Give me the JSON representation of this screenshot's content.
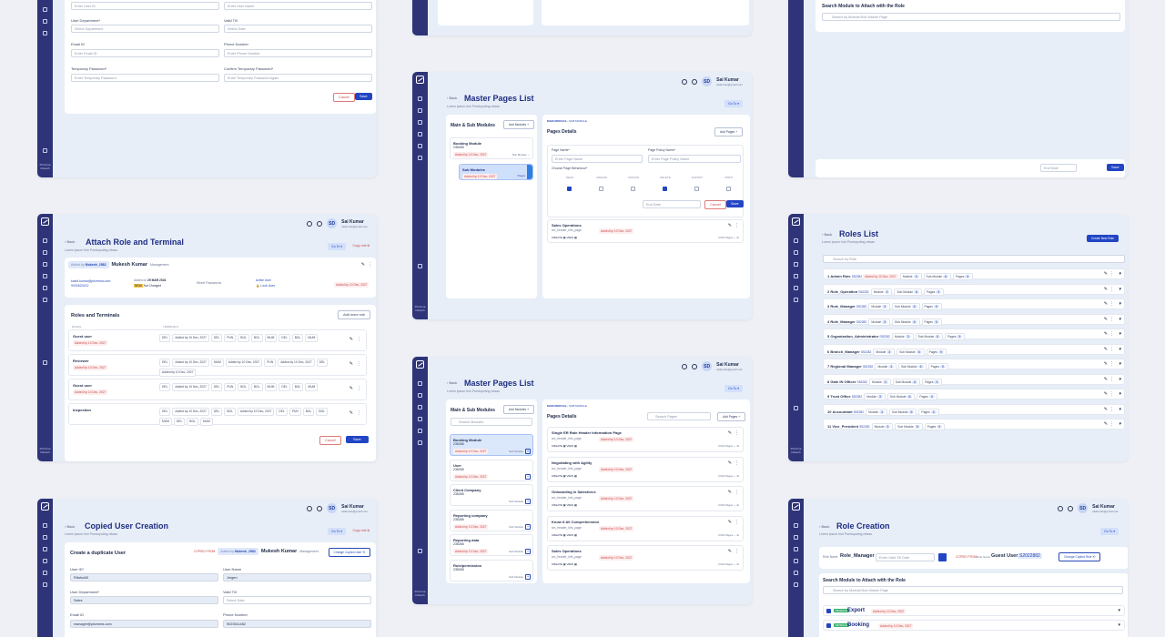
{
  "brand": {
    "sidebar_footer": "Prizmma Infotech"
  },
  "user": {
    "name": "Sai Kumar",
    "email": "saikumar@gmail.com",
    "initials": "SD"
  },
  "common": {
    "back": "Back",
    "subtitle": "Lorem ipsum hsh Puedoputing relaas",
    "goto": "Go To",
    "cancel": "Cancel",
    "save": "Save",
    "added_by": "Added by"
  },
  "s1": {
    "fields": [
      {
        "label": "",
        "placeholder": "Enter User ID"
      },
      {
        "label": "",
        "placeholder": "Enter User Name"
      },
      {
        "label": "User Department*",
        "placeholder": "Select Department"
      },
      {
        "label": "Valid Till",
        "placeholder": "Select Date"
      },
      {
        "label": "Email ID",
        "placeholder": "Enter Email ID"
      },
      {
        "label": "Phone Number",
        "placeholder": "Enter Phone Number"
      },
      {
        "label": "Temporary Password*",
        "placeholder": "Enter Temporary Password"
      },
      {
        "label": "Confirm Temporary Password*",
        "placeholder": "Enter Temporary Password Again"
      }
    ]
  },
  "s2": {
    "title": "Master Pages List",
    "left_title": "Main & Sub Modules",
    "add_modules": "Add Modules",
    "modules": [
      {
        "name": "Booking Module",
        "id": "235265",
        "date": "10 Dec, 2027",
        "sub": "Sub Module"
      }
    ],
    "submodule": {
      "name": "Sub Modules",
      "id": "235265",
      "date": "10 Dec, 2027",
      "tag": "Pages"
    },
    "crumb": [
      "MAIN MODULE",
      "SUB MODULE"
    ],
    "pages_title": "Pages Details",
    "add_pages": "Add Pages",
    "page_name_label": "Page Name*",
    "page_name_ph": "Enter Page Name",
    "policy_label": "Page Policy Name*",
    "policy_ph": "Enter Page Policy Name",
    "behaviour_label": "Choose Page Behaviour*",
    "perms": [
      "READ",
      "CREATE",
      "UPDATE",
      "DELETE",
      "EXPORT",
      "PRINT"
    ],
    "end_date": "End Date",
    "op_name": "Sales Operations",
    "op_page": "sm_header_info_page",
    "op_date": "10 Dec, 2027",
    "op_tags": [
      "CREATE",
      "VIEW"
    ],
    "child_pages": "Child Pages"
  },
  "s3": {
    "search_title": "Search Module to Attach with the Role",
    "search_ph": "Search by Module/Sub Master Page",
    "end_date": "End Date"
  },
  "s4": {
    "title": "Attach Role and Terminal",
    "copy_role": "Copy role",
    "user_chip": "Mukesh_2582",
    "user_name": "Mukesh Kumar",
    "user_role": "Management",
    "email": "kashi.kumar@prizmma.com",
    "phone": "9032623412",
    "added_label": "Added on",
    "added_date": "25 MAR 2024",
    "status": "Not Changed",
    "reset": "Reset Passwords",
    "active_label": "Active User",
    "lock": "Lock User",
    "user_date": "10 Dec, 2027",
    "section": "Roles and Terminals",
    "add_more": "Add more role",
    "col_roles": "ROLES",
    "col_terminals": "TERMINALS",
    "roles": [
      {
        "name": "Guest user",
        "date": "10 Dec, 2027",
        "chips": [
          "DEL",
          "Added by 10 Dec, 2027",
          "DEL",
          "PUN",
          "BGL",
          "BGL",
          "MUM",
          "DEL",
          "BGL",
          "MUM"
        ]
      },
      {
        "name": "Reviewer",
        "date": "10 Dec, 2027",
        "chips": [
          "DEL",
          "Added by 10 Dec, 2027",
          "MUM",
          "Added by 10 Dec, 2027",
          "PUN",
          "Added by 10 Dec, 2027",
          "DEL",
          "Added by 10 Dec, 2027"
        ]
      },
      {
        "name": "Guest user",
        "date": "10 Dec, 2027",
        "chips": [
          "DEL",
          "Added by 10 Dec, 2027",
          "DEL",
          "PUN",
          "BGL",
          "BGL",
          "MUM",
          "DEL",
          "BGL",
          "MUM"
        ]
      },
      {
        "name": "Inspection",
        "date": "",
        "chips": [
          "DEL",
          "Added by 10 Dec, 2027",
          "DEL",
          "BGL",
          "Added by 10 Dec, 2027",
          "DEL",
          "PUN",
          "BGL",
          "BGL",
          "MUM",
          "DEL",
          "BGL",
          "MUM"
        ]
      }
    ]
  },
  "s5": {
    "title": "Master Pages List",
    "search_modules": "Search Modules",
    "search_pages": "Search Pages",
    "modules": [
      {
        "name": "Booking Module",
        "id": "235265",
        "date": "10 Dec, 2027",
        "tag": "Sub Module"
      },
      {
        "name": "User",
        "id": "235265",
        "date": "10 Dec, 2027",
        "tag": ""
      },
      {
        "name": "Client Company",
        "id": "235265",
        "date": "",
        "tag": "Sub Module"
      },
      {
        "name": "Reporting company",
        "id": "235265",
        "date": "10 Dec, 2027",
        "tag": "Sub Module"
      },
      {
        "name": "Reporting data",
        "id": "235265",
        "date": "10 Dec, 2027",
        "tag": "Sub Module"
      },
      {
        "name": "Role/permission",
        "id": "235265",
        "date": "",
        "tag": "Sub Module"
      }
    ],
    "pages": [
      {
        "name": "Single ER Rate Header Information Page",
        "code": "sm_header_info_page",
        "date": "10 Dec, 2027"
      },
      {
        "name": "Negotiating with Agility",
        "code": "sm_header_info_page",
        "date": "10 Dec, 2027"
      },
      {
        "name": "Onboarding in Salesforce",
        "code": "sm_header_info_page",
        "date": "10 Dec, 2027"
      },
      {
        "name": "Know it All Comprehension",
        "code": "sm_header_info_page",
        "date": "10 Dec, 2027"
      },
      {
        "name": "Sales Operations",
        "code": "sm_header_info_page",
        "date": "10 Dec, 2027"
      }
    ]
  },
  "s6": {
    "title": "Roles List",
    "create": "Create New Role",
    "search_ph": "Search by Role",
    "labels": {
      "module": "Module",
      "sub_module": "Sub Module",
      "pages": "Pages"
    },
    "roles": [
      {
        "n": "1",
        "name": "Admin Role",
        "code": "S52282",
        "date": "10 Dec, 2027",
        "m": "3",
        "s": "6",
        "p": "9"
      },
      {
        "n": "2",
        "name": "Role_Operation",
        "code": "S52282",
        "date": "",
        "m": "3",
        "s": "6",
        "p": "9"
      },
      {
        "n": "3",
        "name": "Role_Manager",
        "code": "S52282",
        "date": "",
        "m": "3",
        "s": "6",
        "p": "9"
      },
      {
        "n": "4",
        "name": "Role_Manager",
        "code": "S52282",
        "date": "",
        "m": "3",
        "s": "6",
        "p": "9"
      },
      {
        "n": "5",
        "name": "Organization_Administrator",
        "code": "S52282",
        "date": "",
        "m": "3",
        "s": "6",
        "p": "9"
      },
      {
        "n": "6",
        "name": "Branch_Manager",
        "code": "S52282",
        "date": "",
        "m": "3",
        "s": "6",
        "p": "9"
      },
      {
        "n": "7",
        "name": "Regional Manager",
        "code": "S52282",
        "date": "",
        "m": "3",
        "s": "6",
        "p": "9"
      },
      {
        "n": "8",
        "name": "Gate IN Officer",
        "code": "S52282",
        "date": "",
        "m": "3",
        "s": "6",
        "p": "9"
      },
      {
        "n": "9",
        "name": "Trust Office",
        "code": "S52282",
        "date": "",
        "m": "3",
        "s": "6",
        "p": "9"
      },
      {
        "n": "10",
        "name": "Accountant",
        "code": "S52282",
        "date": "",
        "m": "3",
        "s": "6",
        "p": "9"
      },
      {
        "n": "11",
        "name": "Vice_President",
        "code": "S52282",
        "date": "",
        "m": "3",
        "s": "6",
        "p": "9"
      }
    ]
  },
  "s7": {
    "title": "Copied User Creation",
    "heading": "Create a duplicate User",
    "copied_from": "COPIED FROM",
    "chip": "Mukesh_2582",
    "name": "Mukesh Kumar",
    "role": "Management",
    "change": "Change Copied User",
    "fields": [
      {
        "label": "User ID*",
        "value": "Rifahul40"
      },
      {
        "label": "User Name",
        "value": "Jorgen"
      },
      {
        "label": "User Department*",
        "value": "Sales"
      },
      {
        "label": "Valid Till",
        "value": "Select Date"
      },
      {
        "label": "Email ID",
        "value": "manager@prizmma.com"
      },
      {
        "label": "Phone Number",
        "value": "9023511482"
      }
    ]
  },
  "s8": {
    "title": "Role Creation",
    "role_name_label": "Role Name",
    "role_name": "Role_Manager",
    "valid_ph": "Enter Valid Till Date",
    "copied_from": "COPIED FROM",
    "copied_role": "Guest User",
    "code": "S2022882",
    "change": "Change Copied Role",
    "search_title": "Search Module to Attach with the Role",
    "search_ph": "Search by Module/Sub Master Page",
    "items": [
      {
        "tag": "MODULE",
        "name": "Export",
        "date": "10 Dec, 2027"
      },
      {
        "tag": "MODULE",
        "name": "Booking",
        "date": "10 Dec, 2027"
      }
    ]
  }
}
